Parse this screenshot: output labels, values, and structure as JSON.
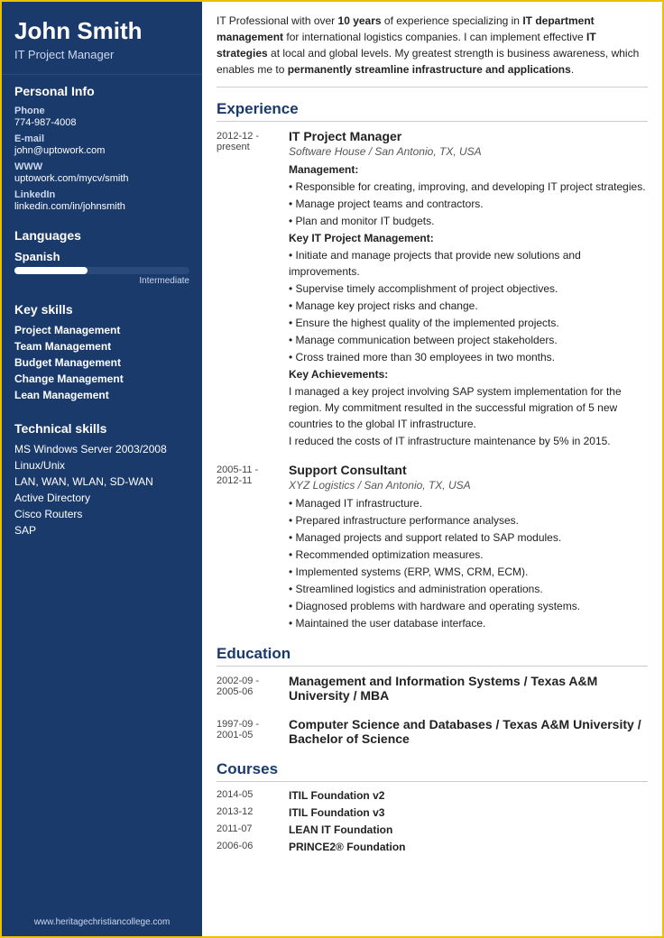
{
  "sidebar": {
    "name": "John Smith",
    "title": "IT Project Manager",
    "sections": {
      "personal_info_title": "Personal Info",
      "phone_label": "Phone",
      "phone_value": "774-987-4008",
      "email_label": "E-mail",
      "email_value": "john@uptowork.com",
      "www_label": "WWW",
      "www_value": "uptowork.com/mycv/smith",
      "linkedin_label": "LinkedIn",
      "linkedin_value": "linkedin.com/in/johnsmith"
    },
    "languages_title": "Languages",
    "languages": [
      {
        "name": "Spanish",
        "level": "Intermediate",
        "percent": 42
      }
    ],
    "keyskills_title": "Key skills",
    "keyskills": [
      "Project Management",
      "Team Management",
      "Budget Management",
      "Change Management",
      "Lean Management"
    ],
    "techskills_title": "Technical skills",
    "techskills": [
      "MS Windows Server 2003/2008",
      "Linux/Unix",
      "LAN, WAN, WLAN, SD-WAN",
      "Active Directory",
      "Cisco Routers",
      "SAP"
    ],
    "footer": "www.heritagechristiancollege.com"
  },
  "main": {
    "summary": "IT Professional with over 10 years of experience specializing in IT department management for international logistics companies. I can implement effective IT strategies at local and global levels. My greatest strength is business awareness, which enables me to permanently streamline infrastructure and applications.",
    "experience_title": "Experience",
    "experience": [
      {
        "date": "2012-12 - present",
        "job_title": "IT Project Manager",
        "company": "Software House / San Antonio, TX, USA",
        "bullets": [
          {
            "bold": "Management:",
            "text": ""
          },
          {
            "bold": "",
            "text": "• Responsible for creating, improving, and developing IT project strategies."
          },
          {
            "bold": "",
            "text": "• Manage project teams and contractors."
          },
          {
            "bold": "",
            "text": "• Plan and monitor IT budgets."
          },
          {
            "bold": "Key IT Project Management:",
            "text": ""
          },
          {
            "bold": "",
            "text": "• Initiate and manage projects that provide new solutions and improvements."
          },
          {
            "bold": "",
            "text": "• Supervise timely accomplishment of project objectives."
          },
          {
            "bold": "",
            "text": "• Manage key project risks and change."
          },
          {
            "bold": "",
            "text": "• Ensure the highest quality of the implemented projects."
          },
          {
            "bold": "",
            "text": "• Manage communication between project stakeholders."
          },
          {
            "bold": "",
            "text": "• Cross trained more than 30 employees in two months."
          },
          {
            "bold": "Key Achievements:",
            "text": ""
          },
          {
            "bold": "",
            "text": "I managed a key project involving SAP system implementation for the region. My commitment resulted in the successful migration of 5 new countries to the global IT infrastructure."
          },
          {
            "bold": "",
            "text": "I reduced the costs of IT infrastructure maintenance by 5% in 2015."
          }
        ]
      },
      {
        "date": "2005-11 - 2012-11",
        "job_title": "Support Consultant",
        "company": "XYZ Logistics / San Antonio, TX, USA",
        "bullets": [
          {
            "bold": "",
            "text": "• Managed IT infrastructure."
          },
          {
            "bold": "",
            "text": "• Prepared infrastructure performance analyses."
          },
          {
            "bold": "",
            "text": "• Managed projects and support related to SAP modules."
          },
          {
            "bold": "",
            "text": "• Recommended optimization measures."
          },
          {
            "bold": "",
            "text": "• Implemented systems (ERP, WMS, CRM, ECM)."
          },
          {
            "bold": "",
            "text": "• Streamlined logistics and administration operations."
          },
          {
            "bold": "",
            "text": "• Diagnosed problems with hardware and operating systems."
          },
          {
            "bold": "",
            "text": "• Maintained the user database interface."
          }
        ]
      }
    ],
    "education_title": "Education",
    "education": [
      {
        "date": "2002-09 - 2005-06",
        "degree": "Management and Information Systems / Texas A&M University / MBA"
      },
      {
        "date": "1997-09 - 2001-05",
        "degree": "Computer Science and Databases / Texas A&M University / Bachelor of Science"
      }
    ],
    "courses_title": "Courses",
    "courses": [
      {
        "date": "2014-05",
        "name": "ITIL Foundation v2"
      },
      {
        "date": "2013-12",
        "name": "ITIL Foundation v3"
      },
      {
        "date": "2011-07",
        "name": "LEAN IT Foundation"
      },
      {
        "date": "2006-06",
        "name": "PRINCE2® Foundation"
      }
    ]
  }
}
